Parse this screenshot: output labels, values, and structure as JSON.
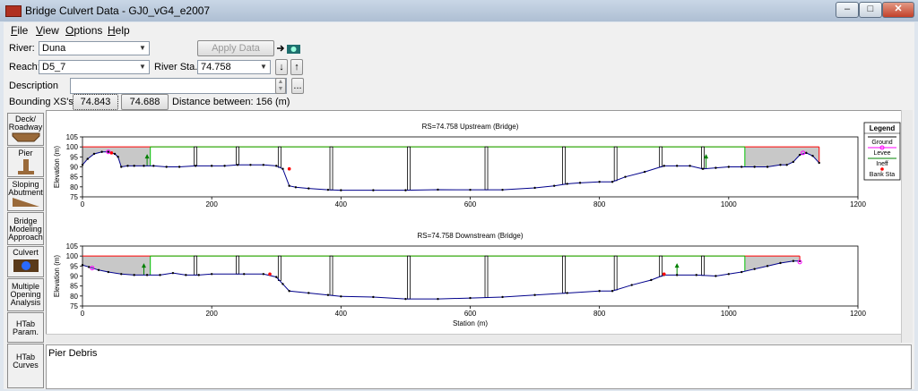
{
  "window": {
    "title": "Bridge Culvert Data - GJ0_vG4_e2007",
    "minimize": "–",
    "maximize": "□",
    "close": "✕"
  },
  "menu": [
    {
      "label": "File",
      "key": "F",
      "rest": "ile"
    },
    {
      "label": "View",
      "key": "V",
      "rest": "iew"
    },
    {
      "label": "Options",
      "key": "O",
      "rest": "ptions"
    },
    {
      "label": "Help",
      "key": "H",
      "rest": "elp"
    }
  ],
  "form": {
    "river_label": "River:",
    "river_value": "Duna",
    "reach_label": "Reach:",
    "reach_value": "D5_7",
    "river_sta_label": "River Sta.:",
    "river_sta_value": "74.758",
    "apply_button": "Apply Data",
    "description_label": "Description",
    "description_value": "",
    "more_button": "...",
    "bounding_label": "Bounding XS's:",
    "bounding_upstream": "74.843",
    "bounding_downstream": "74.688",
    "distance_text": "Distance between: 156 (m)"
  },
  "sidebar": [
    {
      "label": "Deck/ Roadway",
      "icon": "deck-icon"
    },
    {
      "label": "Pier",
      "icon": "pier-icon"
    },
    {
      "label": "Sloping Abutment",
      "icon": "abutment-icon"
    },
    {
      "label": "Bridge Modeling Approach",
      "icon": ""
    },
    {
      "label": "Culvert",
      "icon": "culvert-icon"
    },
    {
      "label": "Multiple Opening Analysis",
      "icon": ""
    },
    {
      "label": "HTab Param.",
      "icon": ""
    },
    {
      "label": "HTab Curves",
      "icon": ""
    }
  ],
  "bottom_text": "Pier Debris",
  "colors": {
    "ground": "#00008b",
    "levee": "#ff00ff",
    "ineff": "#008000",
    "bank": "#ff0000",
    "deck_fill": "#c8c8c8",
    "deck_line": "#ff0000",
    "opening_line": "#00c000",
    "pier": "#000000"
  },
  "chart_data": [
    {
      "type": "line",
      "title": "RS=74.758  Upstream  (Bridge)",
      "ylabel": "Elevation (m)",
      "xlabel": "",
      "xlim": [
        0,
        1200
      ],
      "ylim": [
        75,
        105
      ],
      "xticks": [
        0,
        200,
        400,
        600,
        800,
        1000,
        1200
      ],
      "yticks": [
        75,
        80,
        85,
        90,
        95,
        100,
        105
      ],
      "deck": {
        "x_start": 0,
        "x_end": 1140,
        "high_chord": 100,
        "opening_left": 105,
        "opening_right": 1025
      },
      "piers": [
        175,
        240,
        305,
        385,
        505,
        625,
        745,
        825,
        895,
        960
      ],
      "ineffective": [
        {
          "x": 100,
          "y": 96
        },
        {
          "x": 965,
          "y": 96
        }
      ],
      "ground": {
        "x": [
          0,
          8,
          18,
          30,
          40,
          50,
          55,
          60,
          70,
          80,
          95,
          110,
          130,
          150,
          175,
          200,
          220,
          240,
          260,
          280,
          300,
          310,
          320,
          330,
          350,
          380,
          400,
          450,
          500,
          550,
          600,
          650,
          700,
          730,
          750,
          770,
          800,
          820,
          840,
          870,
          900,
          920,
          940,
          960,
          980,
          1000,
          1020,
          1040,
          1060,
          1080,
          1090,
          1100,
          1110,
          1120,
          1130,
          1140
        ],
        "y": [
          91,
          94,
          96.5,
          97.5,
          97.5,
          96.5,
          95,
          90,
          90.5,
          90.5,
          90.5,
          90.5,
          90,
          90,
          90.5,
          90.5,
          90.5,
          91,
          91,
          91,
          90.5,
          89,
          80.5,
          79.8,
          79.2,
          78.5,
          78.3,
          78.3,
          78.3,
          78.6,
          78.5,
          78.5,
          79.5,
          80.5,
          81.5,
          82,
          82.5,
          82.5,
          85,
          87.5,
          90.5,
          90.5,
          90.5,
          89,
          89.5,
          90,
          90,
          90,
          90,
          91,
          91,
          92.5,
          96,
          97,
          95.5,
          92
        ]
      },
      "levees": [
        {
          "x": 40,
          "y": 97.5
        },
        {
          "x": 1115,
          "y": 97
        }
      ],
      "banks": [
        {
          "x": 45,
          "y": 97
        },
        {
          "x": 320,
          "y": 89
        }
      ]
    },
    {
      "type": "line",
      "title": "RS=74.758  Downstream  (Bridge)",
      "ylabel": "Elevation (m)",
      "xlabel": "Station (m)",
      "xlim": [
        0,
        1200
      ],
      "ylim": [
        75,
        105
      ],
      "xticks": [
        0,
        200,
        400,
        600,
        800,
        1000,
        1200
      ],
      "yticks": [
        75,
        80,
        85,
        90,
        95,
        100,
        105
      ],
      "deck": {
        "x_start": 0,
        "x_end": 1110,
        "high_chord": 100,
        "opening_left": 105,
        "opening_right": 1025
      },
      "piers": [
        175,
        240,
        305,
        385,
        505,
        625,
        745,
        825,
        895,
        960
      ],
      "ineffective": [
        {
          "x": 95,
          "y": 96
        },
        {
          "x": 920,
          "y": 96
        }
      ],
      "ground": {
        "x": [
          0,
          10,
          25,
          40,
          60,
          80,
          100,
          120,
          140,
          160,
          180,
          200,
          250,
          280,
          300,
          310,
          320,
          350,
          380,
          400,
          450,
          500,
          550,
          600,
          650,
          700,
          750,
          800,
          820,
          850,
          880,
          900,
          920,
          950,
          980,
          1000,
          1020,
          1040,
          1060,
          1080,
          1100,
          1110
        ],
        "y": [
          95.5,
          94.5,
          93,
          92,
          91,
          90.5,
          90.5,
          90.5,
          91.5,
          90.5,
          90.5,
          91,
          91,
          91,
          89.5,
          86,
          82.5,
          81.5,
          80.5,
          79.8,
          79.5,
          78.5,
          78.5,
          79,
          79.5,
          80.5,
          81.5,
          82.5,
          82.5,
          85.5,
          88,
          90.5,
          90.5,
          90.5,
          90,
          91,
          92,
          93.5,
          95,
          96.5,
          97.5,
          97.5
        ]
      },
      "levees": [
        {
          "x": 15,
          "y": 94
        },
        {
          "x": 1110,
          "y": 97
        }
      ],
      "banks": [
        {
          "x": 290,
          "y": 91
        },
        {
          "x": 900,
          "y": 91
        }
      ]
    }
  ],
  "legend": {
    "title": "Legend",
    "items": [
      {
        "label": "Ground",
        "color": "#000000"
      },
      {
        "label": "Levee",
        "color": "#ff00ff"
      },
      {
        "label": "Ineff",
        "color": "#008000"
      },
      {
        "label": "Bank Sta",
        "color": "#ff0000"
      }
    ]
  }
}
